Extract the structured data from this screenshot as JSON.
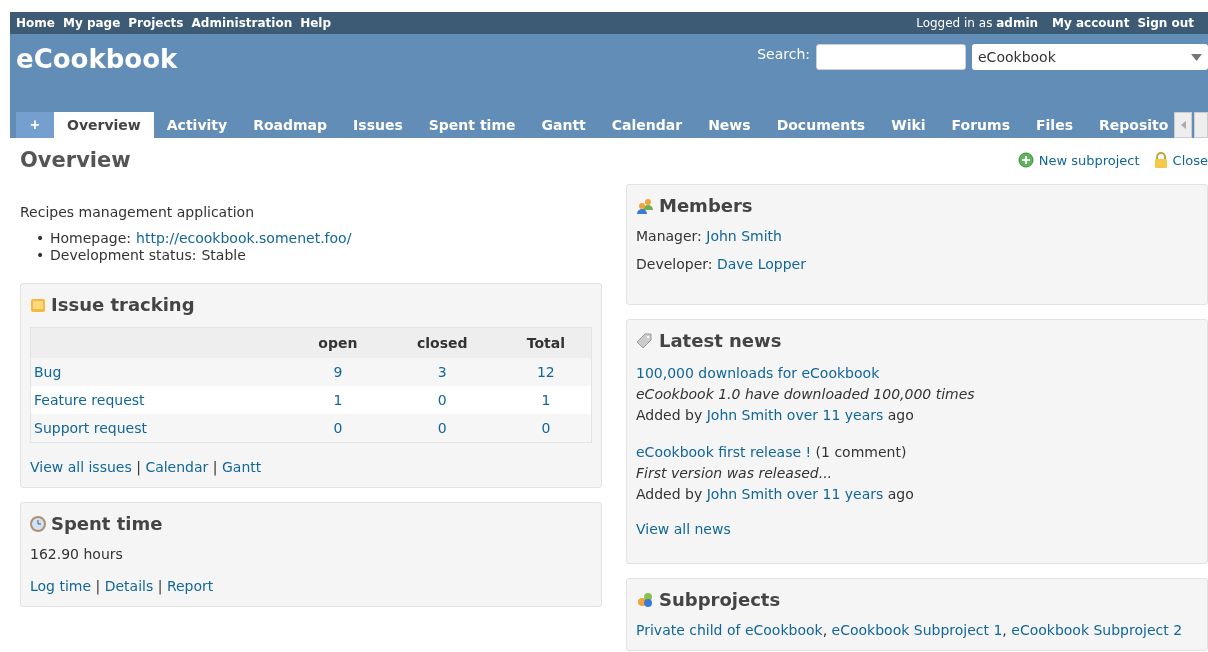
{
  "top_menu": {
    "items": [
      "Home",
      "My page",
      "Projects",
      "Administration",
      "Help"
    ],
    "logged_in": "Logged in as **admin**",
    "account_links": [
      "My account",
      "Sign out"
    ]
  },
  "header": {
    "project_title": "eCookbook",
    "search_label": "Search:",
    "project_select": "eCookbook"
  },
  "new_button": "+",
  "tabs": [
    {
      "label": "Overview",
      "selected": true
    },
    {
      "label": "Activity",
      "selected": false
    },
    {
      "label": "Roadmap",
      "selected": false
    },
    {
      "label": "Issues",
      "selected": false
    },
    {
      "label": "Spent time",
      "selected": false
    },
    {
      "label": "Gantt",
      "selected": false
    },
    {
      "label": "Calendar",
      "selected": false
    },
    {
      "label": "News",
      "selected": false
    },
    {
      "label": "Documents",
      "selected": false
    },
    {
      "label": "Wiki",
      "selected": false
    },
    {
      "label": "Forums",
      "selected": false
    },
    {
      "label": "Files",
      "selected": false
    },
    {
      "label": "Reposito",
      "selected": false
    }
  ],
  "page_title": "Overview",
  "contextual": [
    {
      "label": "New subproject",
      "kind": "add"
    },
    {
      "label": "Close",
      "kind": "lock"
    }
  ],
  "description": "Recipes management application",
  "info_bullet": "•",
  "info": [
    {
      "label": "Homepage:",
      "value": "http://ecookbook.somenet.foo/",
      "kind": "link"
    },
    {
      "label": "Development status:",
      "value": "Stable",
      "kind": "text"
    }
  ],
  "issue_tracking": {
    "title": "Issue tracking",
    "columns": [
      "open",
      "closed",
      "Total"
    ],
    "rows": [
      {
        "tracker": "Bug",
        "values": [
          "9",
          "3",
          "12"
        ]
      },
      {
        "tracker": "Feature request",
        "values": [
          "1",
          "0",
          "1"
        ]
      },
      {
        "tracker": "Support request",
        "values": [
          "0",
          "0",
          "0"
        ]
      }
    ],
    "links": [
      "View all issues",
      "Calendar",
      "Gantt"
    ],
    "separator": "|"
  },
  "spent_time": {
    "title": "Spent time",
    "hours": "162.90 hours",
    "links": [
      "Log time",
      "Details",
      "Report"
    ],
    "separator": "|"
  },
  "members": {
    "title": "Members",
    "roles": [
      {
        "role": "Manager:",
        "name": "John Smith"
      },
      {
        "role": "Developer:",
        "name": "Dave Lopper"
      }
    ]
  },
  "latest_news": {
    "title": "Latest news",
    "items": [
      {
        "title": "100,000 downloads for eCookbook",
        "summary": "eCookbook 1.0 have downloaded 100,000 times",
        "added_by": "Added by",
        "author": "John Smith",
        "age": "over 11 years",
        "ago": "ago"
      },
      {
        "title": "eCookbook first release !",
        "comments": "(1 comment)",
        "summary": "First version was released...",
        "added_by": "Added by",
        "author": "John Smith",
        "age": "over 11 years",
        "ago": "ago"
      }
    ],
    "view_all": "View all news"
  },
  "subprojects": {
    "title": "Subprojects",
    "items": [
      "Private child of eCookbook",
      "eCookbook Subproject 1",
      "eCookbook Subproject 2"
    ],
    "separator": ","
  }
}
